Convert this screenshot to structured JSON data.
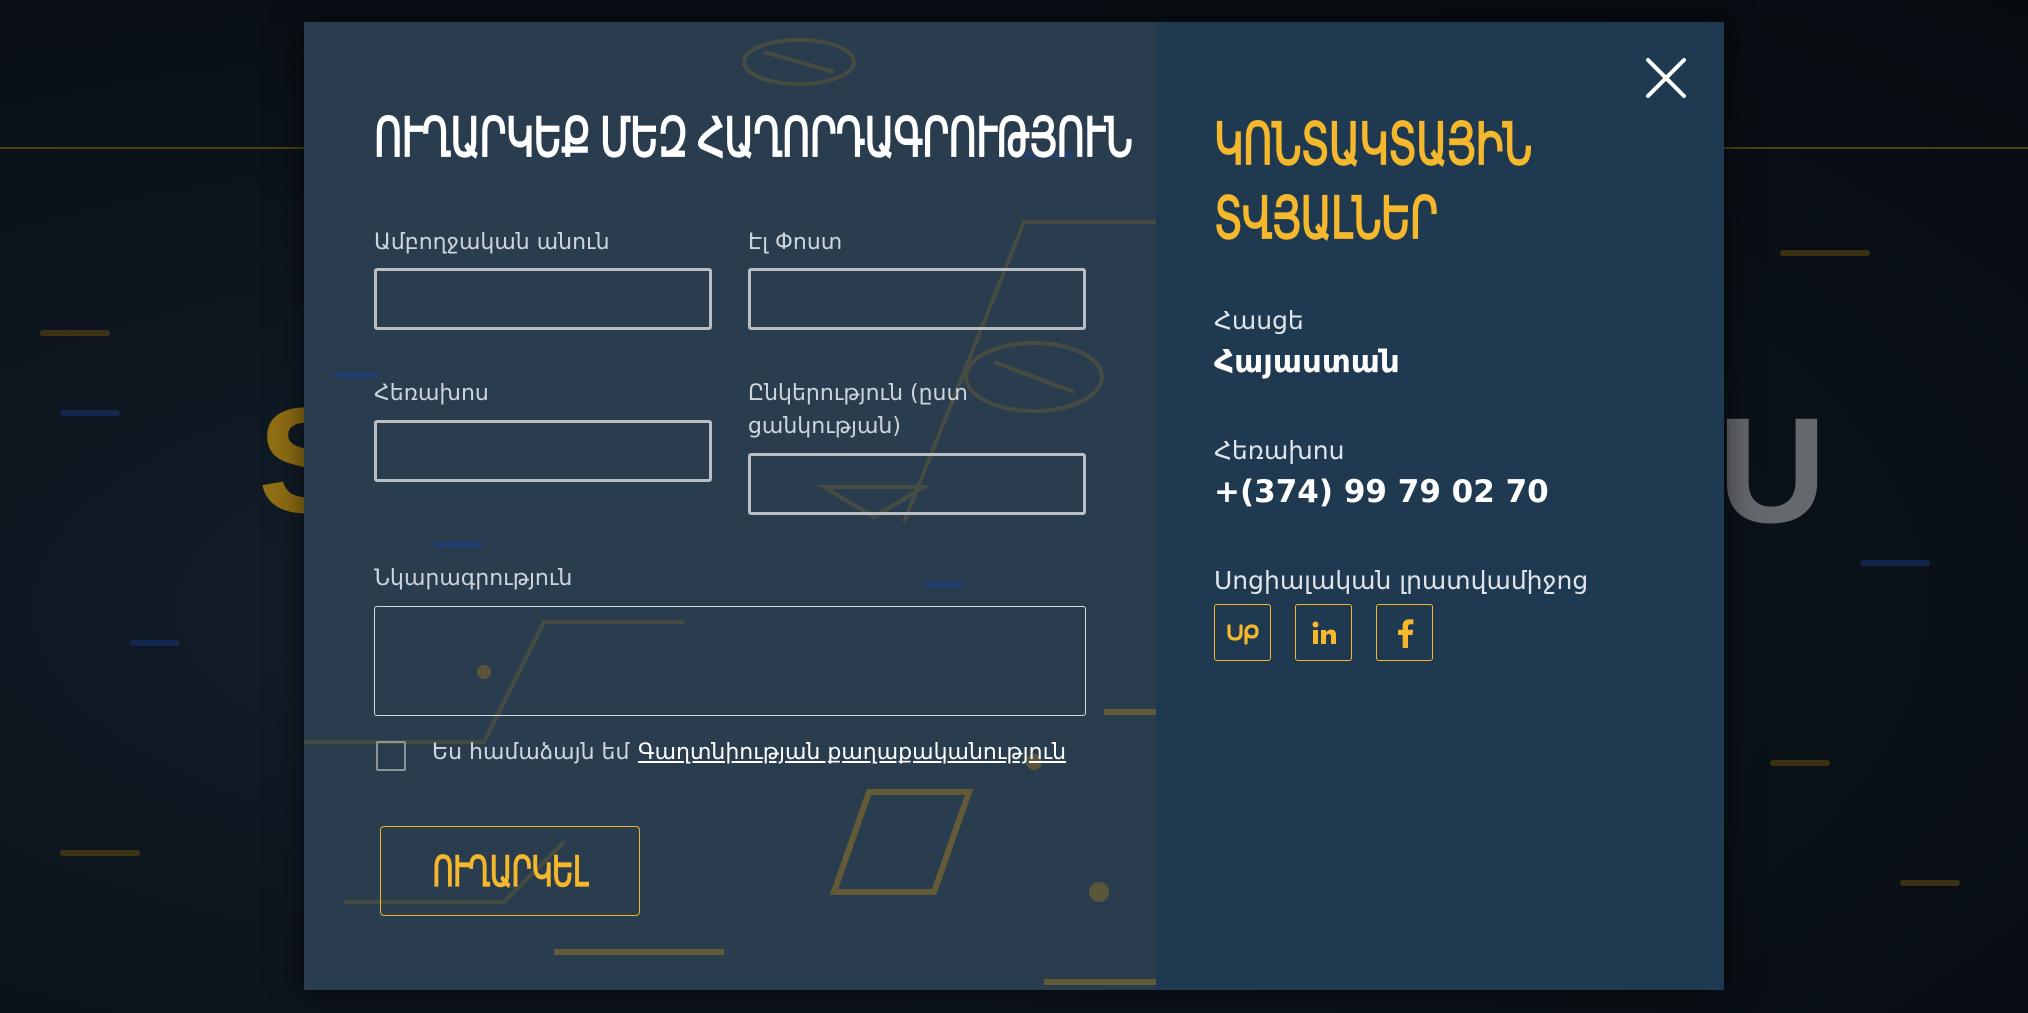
{
  "form": {
    "title": "ՈՒՂԱՐԿԵՔ ՄԵԶ ՀԱՂՈՐԴԱԳՐՈՒԹՅՈՒՆ",
    "full_name_label": "Ամբողջական անուն",
    "email_label": "Էլ Փոստ",
    "phone_label": "Հեռախոս",
    "company_label": "Ընկերություն (ըստ ցանկության)",
    "description_label": "Նկարագրություն",
    "full_name_value": "",
    "email_value": "",
    "phone_value": "",
    "company_value": "",
    "description_value": "",
    "consent_text": "Ես համաձայն եմ",
    "privacy_link": "Գաղտնիության քաղաքականություն",
    "consent_checked": false,
    "submit_label": "ՈՒՂԱՐԿԵԼ"
  },
  "contact": {
    "title_line1": "ԿՈՆՏԱԿՏԱՅԻՆ",
    "title_line2": "ՏՎՅԱԼՆԵՐ",
    "address_label": "Հասցե",
    "address_value": "Հայաստան",
    "phone_label": "Հեռախոս",
    "phone_value": "+(374) 99 79 02 70",
    "social_label": "Սոցիալական լրատվամիջոց",
    "social_links": [
      {
        "icon": "upwork-icon"
      },
      {
        "icon": "linkedin-icon"
      },
      {
        "icon": "facebook-icon"
      }
    ]
  },
  "colors": {
    "accent": "#f5b72c",
    "form_panel": "#2a3d4f",
    "info_panel": "#1f3a50"
  }
}
